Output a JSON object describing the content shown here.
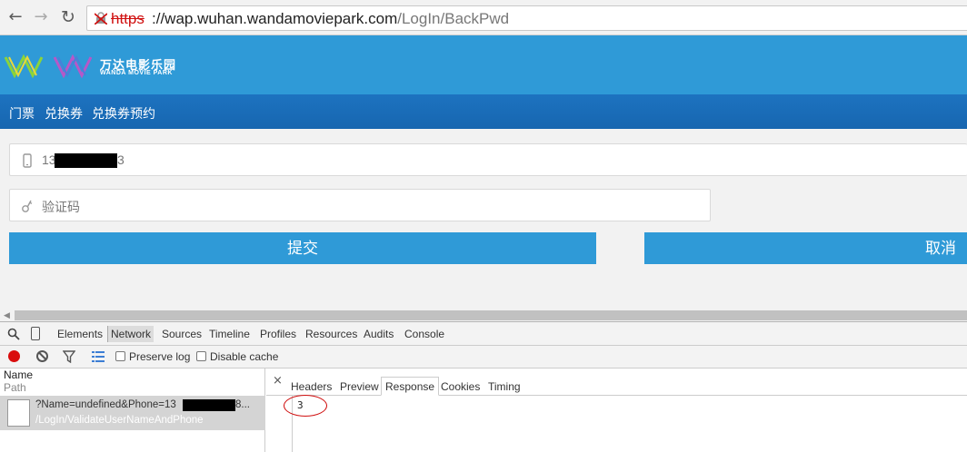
{
  "browser": {
    "url_scheme": "https",
    "url_host": "://wap.wuhan.wandamoviepark.com",
    "url_path": "/LogIn/BackPwd",
    "icons": [
      "back-icon",
      "forward-icon",
      "reload-icon",
      "insecure-lock-icon"
    ]
  },
  "site": {
    "brand_cn": "万达电影乐园",
    "brand_en": "WANDA MOVIE PARK",
    "nav": [
      "门票",
      "兑换券",
      "兑换券预约"
    ],
    "phone_prefix": "13",
    "phone_suffix": "3",
    "code_placeholder": "验证码",
    "submit_label": "提交",
    "cancel_label": "取消",
    "colors": {
      "header": "#2f9ad7",
      "nav": "#1766b0",
      "button": "#2f9ad7"
    }
  },
  "devtools": {
    "tabs": [
      "Elements",
      "Network",
      "Sources",
      "Timeline",
      "Profiles",
      "Resources",
      "Audits",
      "Console"
    ],
    "active_tab": "Network",
    "preserve_log_label": "Preserve log",
    "disable_cache_label": "Disable cache",
    "col_name": "Name",
    "col_path": "Path",
    "request": {
      "name": "?Name=undefined&Phone=13",
      "name_tail": "8...",
      "path": "/LogIn/ValidateUserNameAndPhone"
    },
    "detail_tabs": [
      "Headers",
      "Preview",
      "Response",
      "Cookies",
      "Timing"
    ],
    "active_detail_tab": "Response",
    "close_label": "×",
    "response_body": "3"
  }
}
